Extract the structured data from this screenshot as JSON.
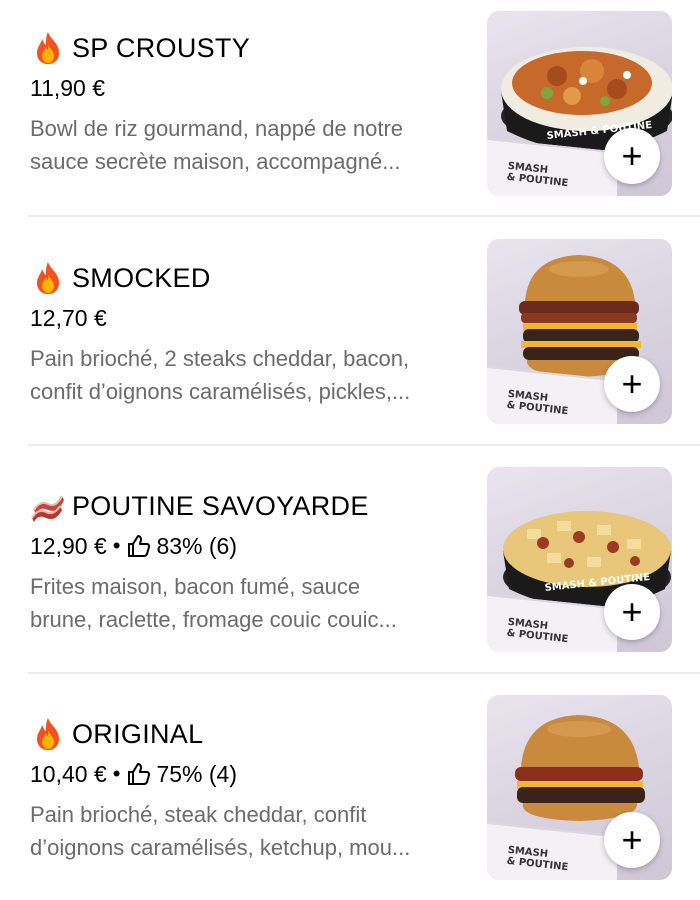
{
  "items": [
    {
      "emoji": "fire-emoji",
      "title": "SP CROUSTY",
      "price": "11,90 €",
      "rating": "",
      "description_line1": "Bowl de riz gourmand, nappé de notre",
      "description_line2": "sauce secrète maison, accompagné...",
      "box_brand": "SMASH & POUTINE",
      "add_label": "+"
    },
    {
      "emoji": "fire-emoji",
      "title": "SMOCKED",
      "price": "12,70 €",
      "rating": "",
      "description_line1": "Pain brioché, 2 steaks cheddar, bacon,",
      "description_line2": "confit d’oignons caramélisés, pickles,...",
      "box_brand": "SMASH & POUTINE",
      "add_label": "+"
    },
    {
      "emoji": "bacon-emoji",
      "title": "POUTINE SAVOYARDE",
      "price": "12,90 €",
      "rating": "83% (6)",
      "description_line1": "Frites maison, bacon fumé, sauce",
      "description_line2": "brune, raclette, fromage couic couic...",
      "box_brand": "SMASH & POUTINE",
      "add_label": "+"
    },
    {
      "emoji": "fire-emoji",
      "title": "ORIGINAL",
      "price": "10,40 €",
      "rating": "75% (4)",
      "description_line1": "Pain brioché, steak cheddar, confit",
      "description_line2": "d’oignons caramélisés, ketchup, mou...",
      "box_brand": "SMASH & POUTINE",
      "add_label": "+"
    }
  ],
  "rating_separator": "•",
  "colors": {
    "text_primary": "#000000",
    "text_secondary": "#6b6b6b",
    "divider": "#ececec",
    "photo_bg": "#dcd5e2"
  }
}
